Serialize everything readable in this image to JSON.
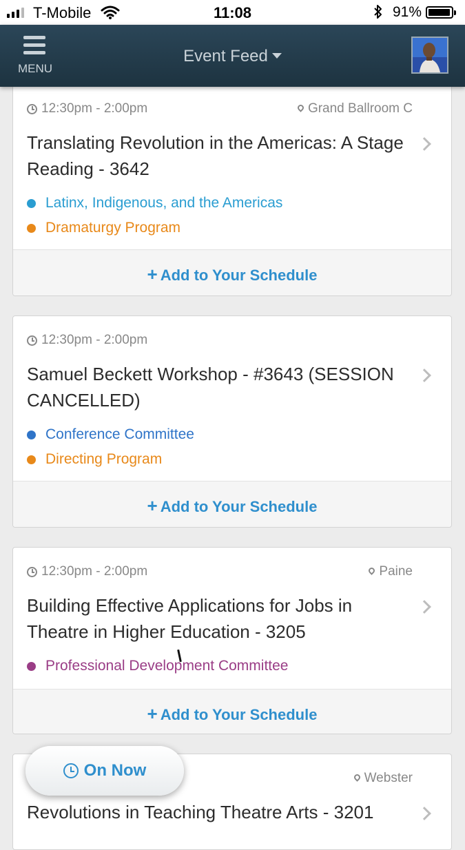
{
  "status_bar": {
    "carrier": "T-Mobile",
    "time": "11:08",
    "battery": "91%"
  },
  "nav": {
    "menu_label": "MENU",
    "title": "Event Feed"
  },
  "events": [
    {
      "time": "12:30pm - 2:00pm",
      "location": "Grand Ballroom C",
      "title": "Translating Revolution in the Americas: A Stage Reading - 3642",
      "tags": [
        {
          "label": "Latinx, Indigenous, and the Americas",
          "color": "#2a9dd1"
        },
        {
          "label": "Dramaturgy Program",
          "color": "#e8891a"
        }
      ],
      "action": "Add to Your Schedule"
    },
    {
      "time": "12:30pm - 2:00pm",
      "location": "",
      "title": "Samuel Beckett Workshop - #3643 (SESSION CANCELLED)",
      "tags": [
        {
          "label": "Conference Committee",
          "color": "#2f74c8"
        },
        {
          "label": "Directing Program",
          "color": "#e8891a"
        }
      ],
      "action": "Add to Your Schedule"
    },
    {
      "time": "12:30pm - 2:00pm",
      "location": "Paine",
      "title": "Building Effective Applications for Jobs in Theatre in Higher Education - 3205",
      "tags": [
        {
          "label": "Professional Development Committee",
          "color": "#9a3d86"
        }
      ],
      "action": "Add to Your Schedule"
    },
    {
      "time": "",
      "location": "Webster",
      "title": "Revolutions in Teaching Theatre Arts - 3201",
      "tags": [],
      "action": ""
    }
  ],
  "on_now": {
    "label": "On Now"
  }
}
